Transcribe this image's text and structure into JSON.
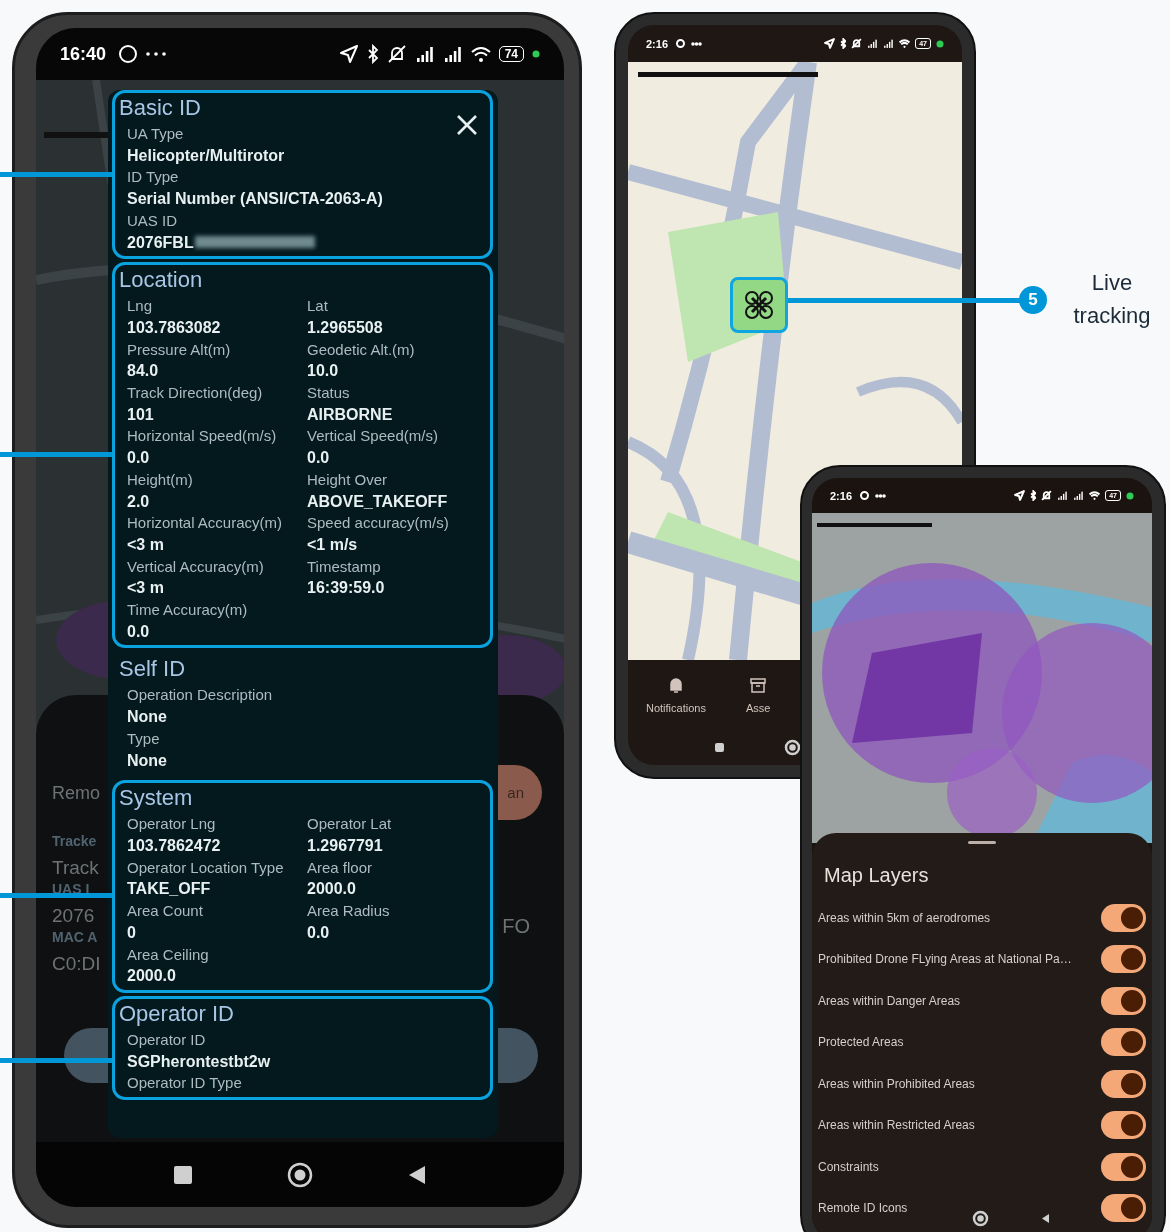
{
  "detail_phone": {
    "status_bar": {
      "time": "16:40",
      "battery": "74"
    },
    "background": {
      "left_fragments": [
        {
          "text": "Remo",
          "kind": "title"
        },
        {
          "text": "Tracke",
          "kind": "small"
        },
        {
          "text": "Track",
          "kind": "large"
        },
        {
          "text": "UAS I",
          "kind": "small"
        },
        {
          "text": "2076",
          "kind": "large"
        },
        {
          "text": "MAC A",
          "kind": "small"
        },
        {
          "text": "C0:DI",
          "kind": "large"
        }
      ],
      "button_fragment": "an",
      "right_fragment": "FO"
    },
    "panel": {
      "sections": [
        {
          "title": "Basic ID",
          "kind": "single",
          "highlighted": true,
          "fields": [
            {
              "label": "UA Type",
              "value": "Helicopter/Multirotor"
            },
            {
              "label": "ID Type",
              "value": "Serial Number (ANSI/CTA-2063-A)"
            },
            {
              "label": "UAS ID",
              "value": "2076FBL",
              "redacted": true
            }
          ]
        },
        {
          "title": "Location",
          "kind": "double",
          "highlighted": true,
          "fields": [
            {
              "label": "Lng",
              "value": "103.7863082"
            },
            {
              "label": "Lat",
              "value": "1.2965508"
            },
            {
              "label": "Pressure Alt(m)",
              "value": "84.0"
            },
            {
              "label": "Geodetic Alt.(m)",
              "value": "10.0"
            },
            {
              "label": "Track Direction(deg)",
              "value": "101"
            },
            {
              "label": "Status",
              "value": "AIRBORNE"
            },
            {
              "label": "Horizontal Speed(m/s)",
              "value": "0.0"
            },
            {
              "label": "Vertical Speed(m/s)",
              "value": "0.0"
            },
            {
              "label": "Height(m)",
              "value": "2.0"
            },
            {
              "label": "Height Over",
              "value": "ABOVE_TAKEOFF"
            },
            {
              "label": "Horizontal Accuracy(m)",
              "value": "<3 m"
            },
            {
              "label": "Speed accuracy(m/s)",
              "value": "<1 m/s"
            },
            {
              "label": "Vertical Accuracy(m)",
              "value": "<3 m"
            },
            {
              "label": "Timestamp",
              "value": "16:39:59.0"
            },
            {
              "label": "Time Accuracy(m)",
              "value": "0.0"
            }
          ]
        },
        {
          "title": "Self ID",
          "kind": "single",
          "highlighted": false,
          "fields": [
            {
              "label": "Operation Description",
              "value": "None"
            },
            {
              "label": "Type",
              "value": "None"
            }
          ]
        },
        {
          "title": "System",
          "kind": "double",
          "highlighted": true,
          "fields": [
            {
              "label": "Operator Lng",
              "value": "103.7862472"
            },
            {
              "label": "Operator Lat",
              "value": "1.2967791"
            },
            {
              "label": "Operator Location Type",
              "value": "TAKE_OFF"
            },
            {
              "label": "Area floor",
              "value": "2000.0"
            },
            {
              "label": "Area Count",
              "value": "0"
            },
            {
              "label": "Area Radius",
              "value": "0.0"
            },
            {
              "label": "Area Ceiling",
              "value": "2000.0"
            }
          ]
        },
        {
          "title": "Operator ID",
          "kind": "single",
          "highlighted": true,
          "fields": [
            {
              "label": "Operator ID",
              "value": "SGPherontestbt2w"
            },
            {
              "label": "Operator ID Type"
            }
          ]
        }
      ]
    }
  },
  "tracking_phone": {
    "status_bar": {
      "time": "2:16",
      "battery": "47"
    },
    "nav": [
      {
        "label": "Notifications",
        "kind": "bell"
      },
      {
        "label": "Asse",
        "kind": "archive"
      }
    ]
  },
  "live_tracking_callout": {
    "number": "5",
    "label": "Live tracking"
  },
  "layers_phone": {
    "status_bar": {
      "time": "2:16",
      "battery": "47"
    },
    "sheet": {
      "title": "Map Layers",
      "layers": [
        {
          "label": "Areas within 5km of aerodromes",
          "on": true
        },
        {
          "label": "Prohibited Drone FLying Areas at National Pa…",
          "on": true
        },
        {
          "label": "Areas within Danger Areas",
          "on": true
        },
        {
          "label": "Protected Areas",
          "on": true
        },
        {
          "label": "Areas within Prohibited Areas",
          "on": true
        },
        {
          "label": "Areas within Restricted Areas",
          "on": true
        },
        {
          "label": "Constraints",
          "on": true
        },
        {
          "label": "Remote ID Icons",
          "on": true
        }
      ]
    }
  }
}
